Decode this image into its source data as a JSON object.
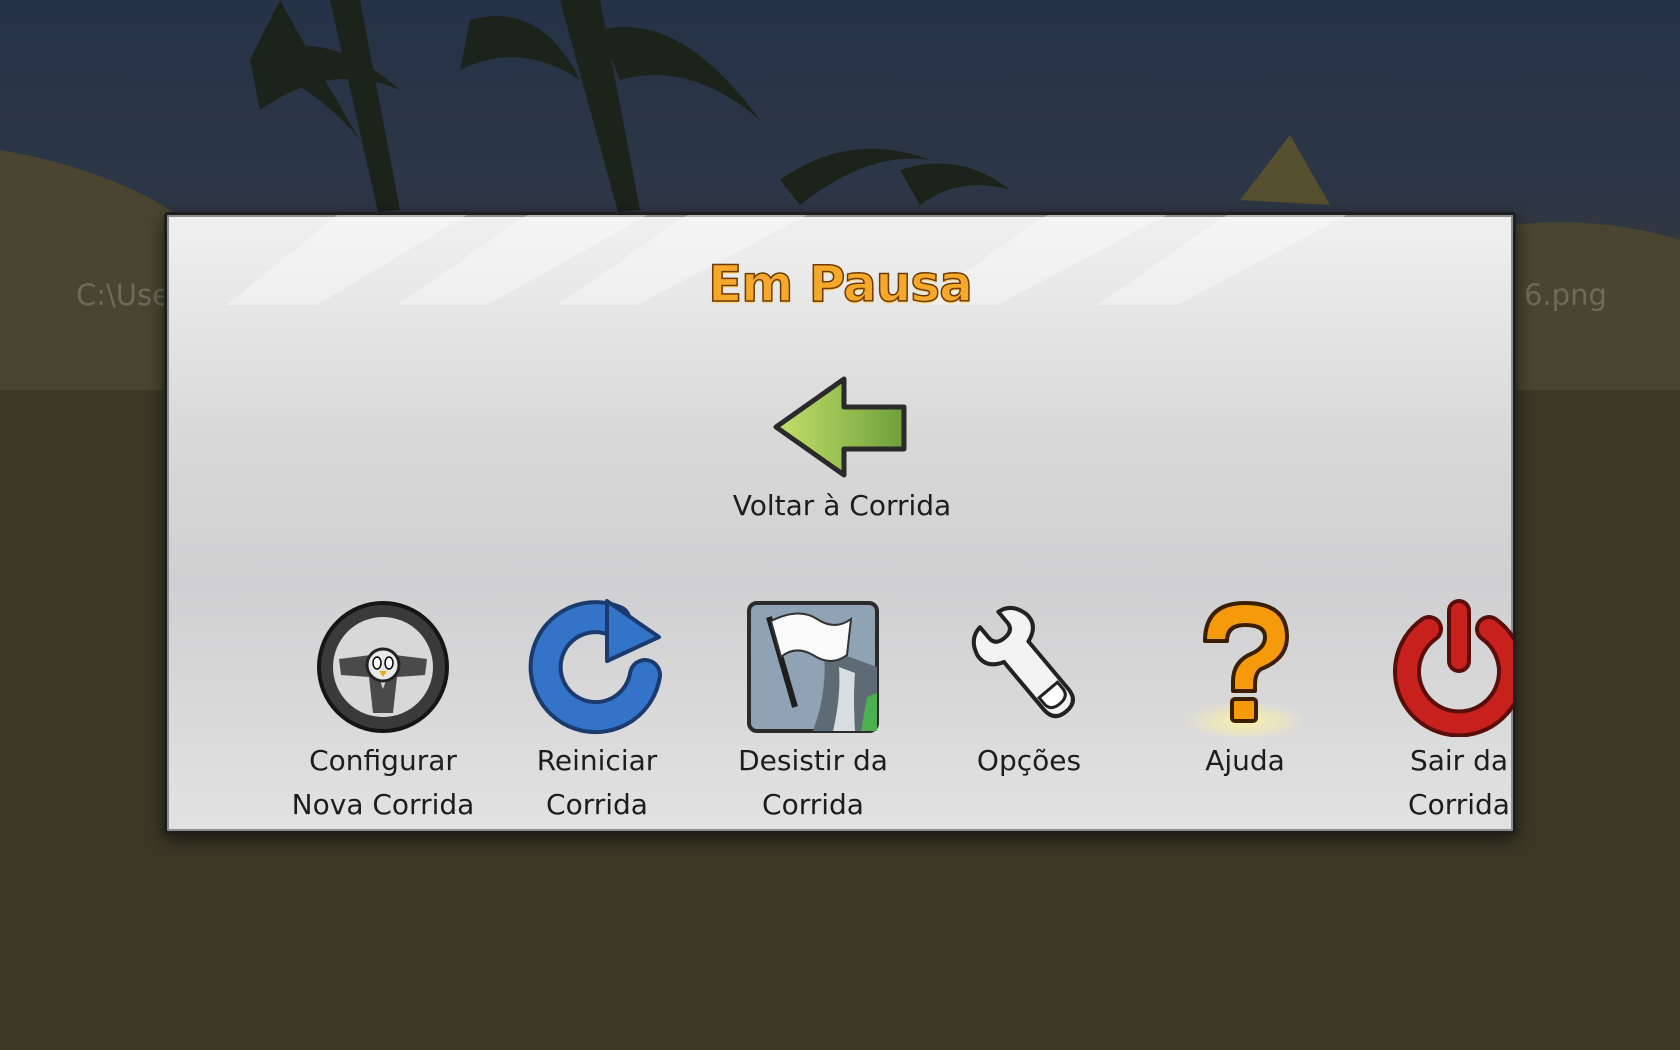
{
  "background": {
    "path_left": "C:\\Use",
    "path_right": "6.png"
  },
  "dialog": {
    "title": "Em Pausa",
    "resume": {
      "label": "Voltar à Corrida",
      "icon": "back-arrow-icon"
    },
    "actions": [
      {
        "label": "Configurar\nNova Corrida",
        "icon": "steering-wheel-icon"
      },
      {
        "label": "Reiniciar\nCorrida",
        "icon": "restart-arrow-icon"
      },
      {
        "label": "Desistir da\nCorrida",
        "icon": "white-flag-icon"
      },
      {
        "label": "Opções",
        "icon": "wrench-icon"
      },
      {
        "label": "Ajuda",
        "icon": "question-mark-icon"
      },
      {
        "label": "Sair da Corrida",
        "icon": "power-icon"
      }
    ]
  },
  "colors": {
    "title": "#f6a82a",
    "arrow": "#8fc33a",
    "restart": "#2f6fc4",
    "help": "#f49a0b",
    "power": "#c8201c"
  }
}
